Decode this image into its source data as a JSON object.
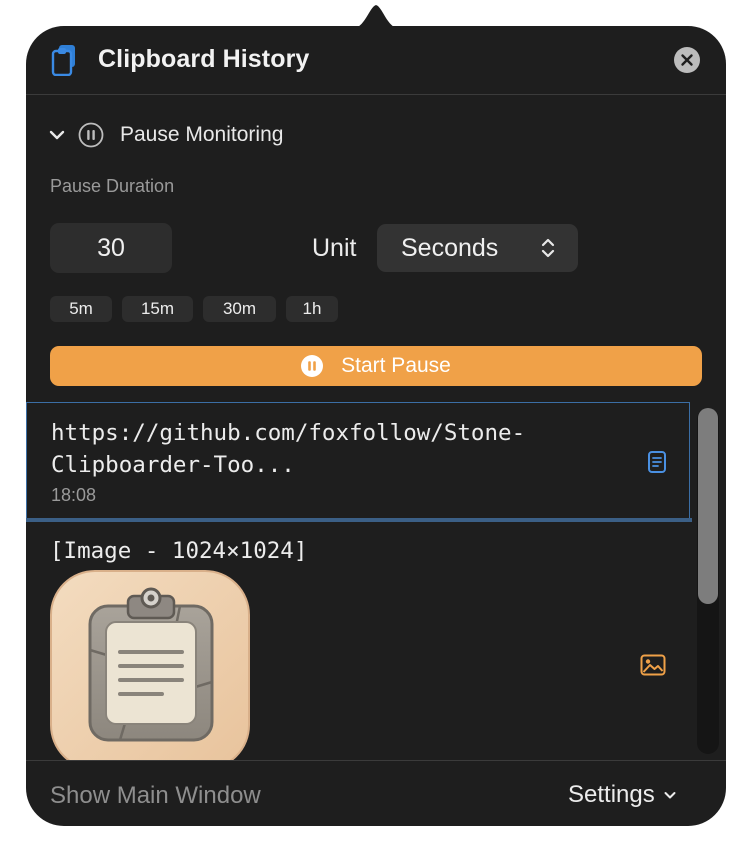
{
  "header": {
    "title": "Clipboard History",
    "app_icon": "clipboard-app-icon",
    "close_icon": "close-icon"
  },
  "pause": {
    "section_label": "Pause Monitoring",
    "expanded": true,
    "duration_label": "Pause Duration",
    "duration_value": "30",
    "unit_label": "Unit",
    "unit_selected": "Seconds",
    "presets": [
      "5m",
      "15m",
      "30m",
      "1h"
    ],
    "start_label": "Start Pause"
  },
  "items": [
    {
      "type": "text",
      "text_line1": "https://github.com/foxfollow/Stone-",
      "text_line2": "Clipboarder-Too...",
      "time": "18:08",
      "selected": true,
      "type_icon": "document-icon"
    },
    {
      "type": "image",
      "title": "[Image - 1024×1024]",
      "type_icon": "photo-icon"
    }
  ],
  "footer": {
    "show_main": "Show Main Window",
    "settings": "Settings"
  },
  "colors": {
    "background": "#1e1e1e",
    "accent_orange": "#f0a148",
    "selection_blue": "#3b6ea5",
    "doc_icon_blue": "#4a90e2"
  }
}
